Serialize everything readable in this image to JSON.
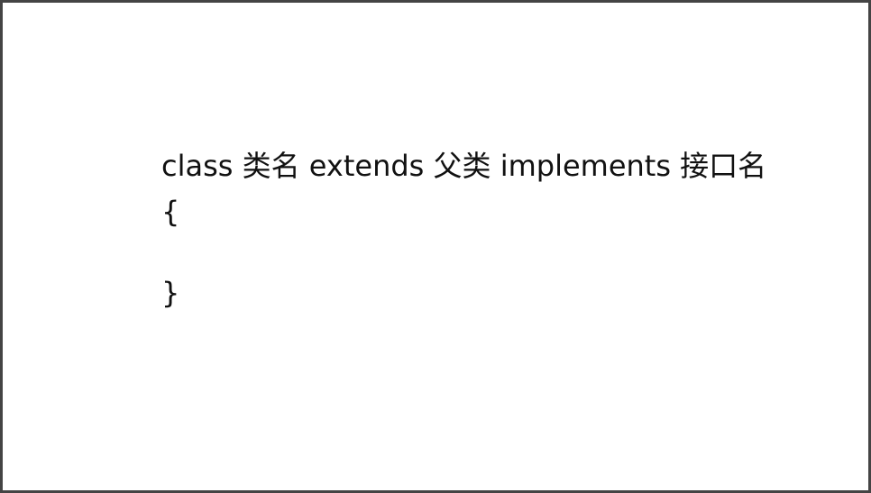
{
  "slide": {
    "lines": [
      "class 类名 extends 父类 implements 接口名",
      "{",
      "}"
    ]
  },
  "colors": {
    "text": "#111111",
    "border": "#444444",
    "background": "#ffffff"
  }
}
